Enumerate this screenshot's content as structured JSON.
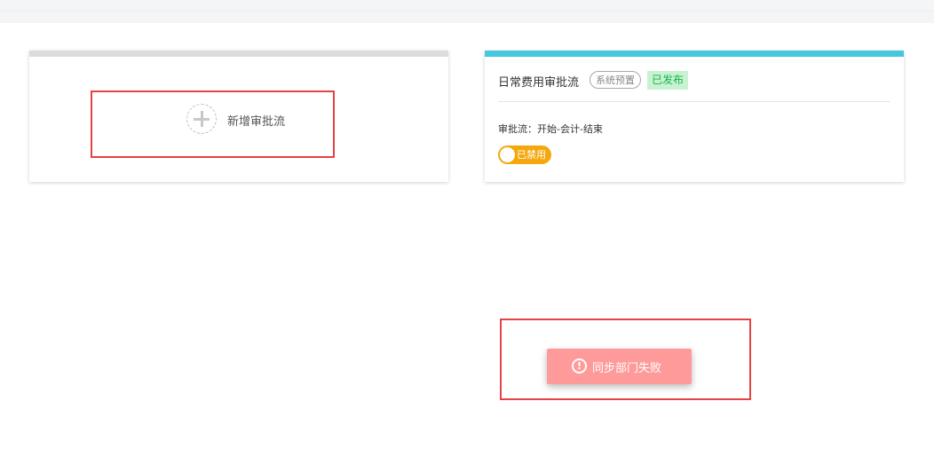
{
  "add_card": {
    "label": "新增审批流",
    "icon": "plus-icon"
  },
  "flow_card": {
    "title": "日常费用审批流",
    "preset_tag": "系统预置",
    "status_tag": "已发布",
    "steps": "审批流：开始-会计-结束",
    "toggle_label": "已禁用",
    "accent_color": "#45c7dd",
    "toggle_color": "#f5a70e"
  },
  "toast": {
    "icon": "exclamation-circle-icon",
    "icon_glyph": "!",
    "message": "同步部门失败",
    "color": "#ff9a9a"
  }
}
